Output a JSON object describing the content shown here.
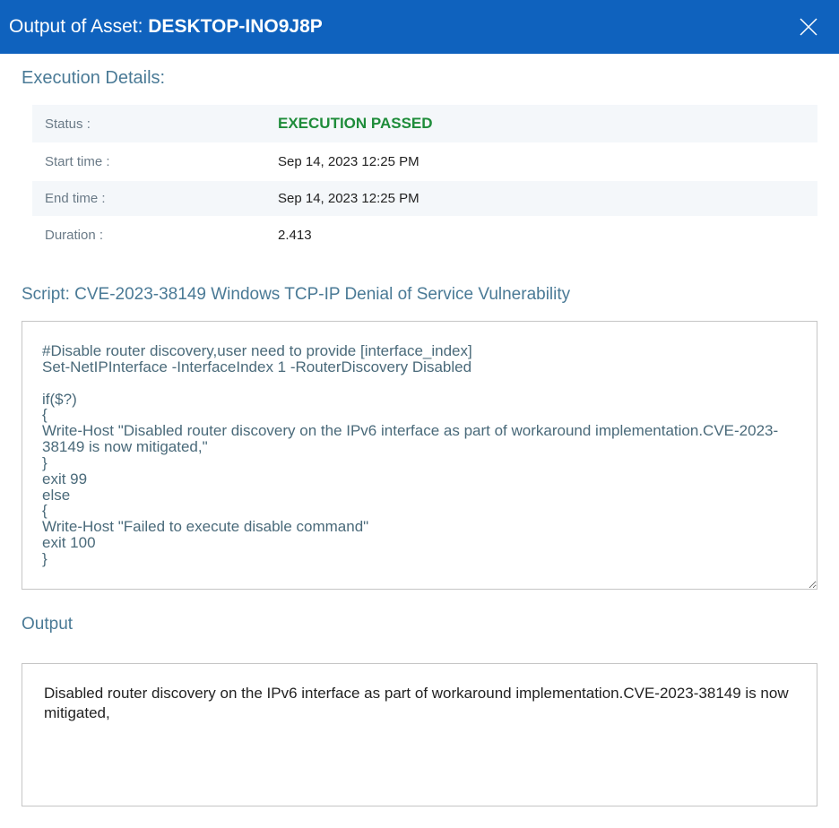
{
  "header": {
    "title_prefix": "Output of Asset: ",
    "asset_name": "DESKTOP-INO9J8P"
  },
  "execution_details": {
    "heading": "Execution Details:",
    "rows": [
      {
        "label": "Status :",
        "value": "EXECUTION PASSED",
        "is_status": true
      },
      {
        "label": "Start time :",
        "value": "Sep 14, 2023 12:25 PM"
      },
      {
        "label": "End time :",
        "value": "Sep 14, 2023 12:25 PM"
      },
      {
        "label": "Duration :",
        "value": "2.413"
      }
    ]
  },
  "script": {
    "heading": "Script: CVE-2023-38149 Windows TCP-IP Denial of Service Vulnerability",
    "body": "#Disable router discovery,user need to provide [interface_index]\nSet-NetIPInterface -InterfaceIndex 1 -RouterDiscovery Disabled\n\nif($?)\n{\nWrite-Host \"Disabled router discovery on the IPv6 interface as part of workaround implementation.CVE-2023-38149 is now mitigated,\"\n}\nexit 99\nelse\n{\nWrite-Host \"Failed to execute disable command\"\nexit 100\n}"
  },
  "output": {
    "heading": "Output",
    "body": "Disabled router discovery on the IPv6 interface as part of workaround implementation.CVE-2023-38149 is now mitigated,"
  }
}
